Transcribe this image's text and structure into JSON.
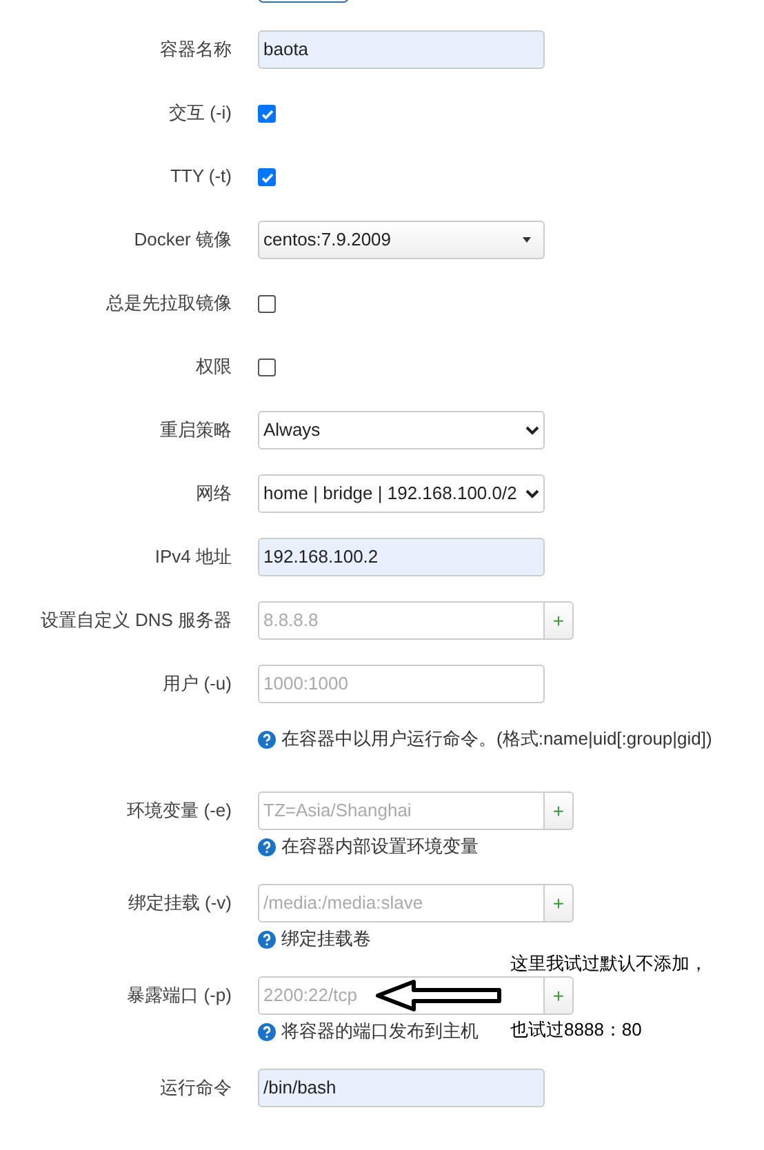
{
  "rows": [
    {
      "kind": "text",
      "label": "容器名称",
      "value": "baota",
      "autofilled": true
    },
    {
      "kind": "checkbox",
      "label": "交互 (-i)",
      "checked": true
    },
    {
      "kind": "checkbox",
      "label": "TTY (-t)",
      "checked": true
    },
    {
      "kind": "combobox",
      "label": "Docker 镜像",
      "value": "centos:7.9.2009"
    },
    {
      "kind": "checkbox",
      "label": "总是先拉取镜像",
      "checked": false
    },
    {
      "kind": "checkbox",
      "label": "权限",
      "checked": false
    },
    {
      "kind": "select",
      "label": "重启策略",
      "value": "Always"
    },
    {
      "kind": "select",
      "label": "网络",
      "value": "home | bridge | 192.168.100.0/2"
    },
    {
      "kind": "text",
      "label": "IPv4 地址",
      "value": "192.168.100.2",
      "autofilled": true
    },
    {
      "kind": "list",
      "label": "设置自定义 DNS 服务器",
      "placeholder": "8.8.8.8",
      "add": "+"
    },
    {
      "kind": "text",
      "label": "用户 (-u)",
      "placeholder": "1000:1000",
      "autofilled": false
    },
    {
      "kind": "help",
      "help": "在容器中以用户运行命令。(格式:name|uid[:group|gid])"
    },
    {
      "kind": "list",
      "label": "环境变量 (-e)",
      "placeholder": "TZ=Asia/Shanghai",
      "add": "+",
      "help": "在容器内部设置环境变量"
    },
    {
      "kind": "list",
      "label": "绑定挂载 (-v)",
      "placeholder": "/media:/media:slave",
      "add": "+",
      "help": "绑定挂载卷"
    },
    {
      "kind": "list",
      "label": "暴露端口 (-p)",
      "placeholder": "2200:22/tcp",
      "add": "+",
      "help": "将容器的端口发布到主机",
      "note": [
        "这里我试过默认不添加，",
        "也试过8888：80"
      ]
    },
    {
      "kind": "text",
      "label": "运行命令",
      "value": "/bin/bash",
      "autofilled": true
    }
  ]
}
